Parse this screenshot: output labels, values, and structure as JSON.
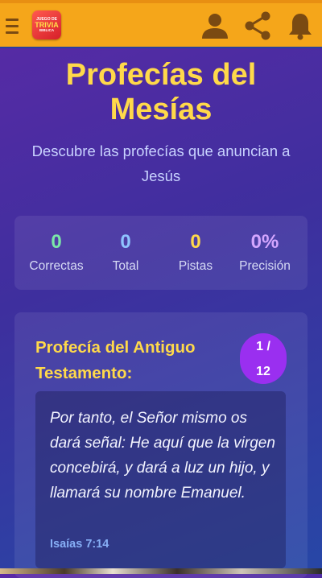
{
  "header": {
    "logo_line1": "JUEGO DE",
    "logo_line2": "TRIVIA",
    "logo_line3": "BIBLICA",
    "icons": [
      "menu-icon",
      "user-icon",
      "share-icon",
      "bell-icon"
    ],
    "accent_color": "#f5a61a"
  },
  "page": {
    "title": "Profecías del Mesías",
    "subtitle": "Descubre las profecías que anuncian a Jesús"
  },
  "stats": [
    {
      "value": "0",
      "label": "Correctas",
      "color": "#7be7a8"
    },
    {
      "value": "0",
      "label": "Total",
      "color": "#8fc4ff"
    },
    {
      "value": "0",
      "label": "Pistas",
      "color": "#ffd94a"
    },
    {
      "value": "0%",
      "label": "Precisión",
      "color": "#d4a6ff"
    }
  ],
  "card": {
    "title": "Profecía del Antiguo Testamento:",
    "counter_current": "1 /",
    "counter_total": "12",
    "quote": "Por tanto, el Señor mismo os dará señal: He aquí que la virgen concebirá, y dará a luz un hijo, y llamará su nombre Emanuel.",
    "reference": "Isaías 7:14"
  }
}
